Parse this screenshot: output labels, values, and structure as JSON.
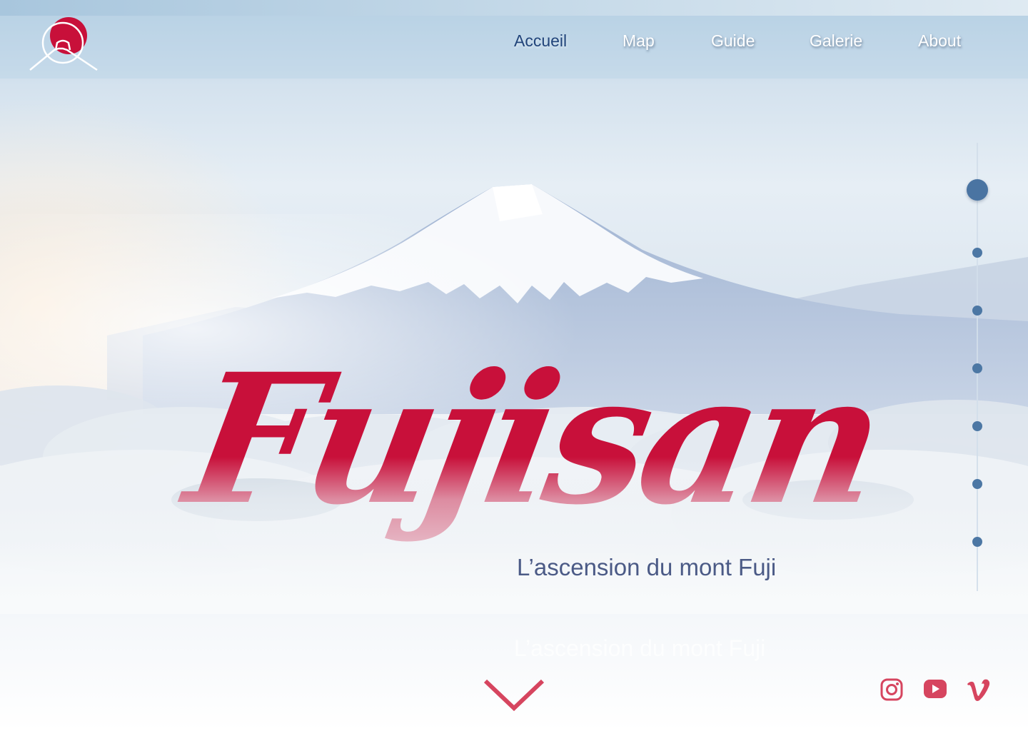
{
  "nav": {
    "items": [
      {
        "label": "Accueil",
        "active": true
      },
      {
        "label": "Map",
        "active": false
      },
      {
        "label": "Guide",
        "active": false
      },
      {
        "label": "Galerie",
        "active": false
      },
      {
        "label": "About",
        "active": false
      }
    ]
  },
  "hero": {
    "title": "Fujisan",
    "subtitle": "L’ascension du mont Fuji",
    "ghost_subtitle": "L’ascension du mont Fuji"
  },
  "pager": {
    "count": 7,
    "active_index": 0
  },
  "social": [
    {
      "name": "instagram-icon"
    },
    {
      "name": "youtube-icon"
    },
    {
      "name": "vimeo-icon"
    }
  ],
  "colors": {
    "brand_red": "#c8103a",
    "nav_active": "#21447a",
    "pager_dot": "#4c77a4",
    "subtitle": "#4b5a86",
    "social": "#d6455f"
  }
}
